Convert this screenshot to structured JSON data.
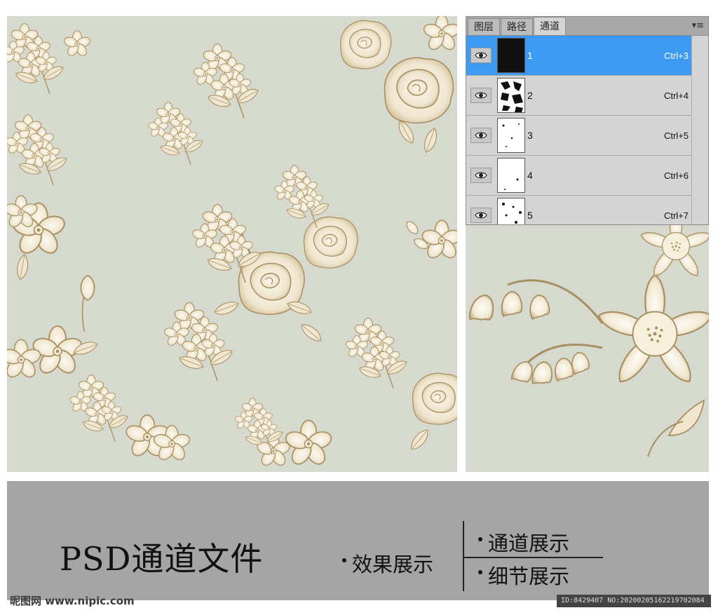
{
  "ps_panel": {
    "tabs": [
      "图层",
      "路径",
      "通道"
    ],
    "active_tab": "通道",
    "menu_icon": "panel-menu-icon",
    "channels": [
      {
        "name": "1",
        "shortcut": "Ctrl+3",
        "selected": true
      },
      {
        "name": "2",
        "shortcut": "Ctrl+4",
        "selected": false
      },
      {
        "name": "3",
        "shortcut": "Ctrl+5",
        "selected": false
      },
      {
        "name": "4",
        "shortcut": "Ctrl+6",
        "selected": false
      },
      {
        "name": "5",
        "shortcut": "Ctrl+7",
        "selected": false
      }
    ],
    "selection_color": "#3c9af2"
  },
  "banner": {
    "title": "PSD通道文件",
    "effect": "效果展示",
    "channel_show": "通道展示",
    "detail_show": "细节展示"
  },
  "watermark": {
    "site": "昵图网 www.nipic.com",
    "id": "ID:8429407 NO:20200205162219702084"
  },
  "colors": {
    "pattern_bg": "#d6d9ce",
    "flower_fill": "#f6f1e3",
    "flower_stroke": "#a88f62",
    "banner_bg": "#a5a5a5"
  }
}
